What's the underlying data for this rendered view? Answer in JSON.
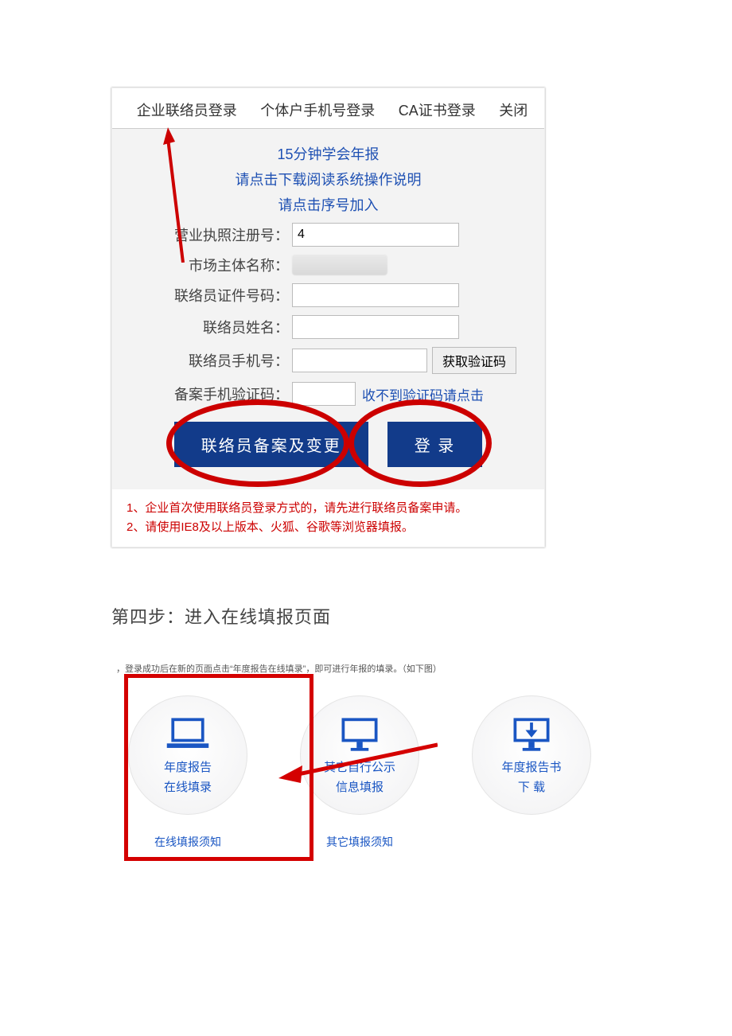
{
  "login": {
    "tabs": {
      "t1": "企业联络员登录",
      "t2": "个体户手机号登录",
      "t3": "CA证书登录",
      "close": "关闭"
    },
    "links": {
      "l1": "15分钟学会年报",
      "l2": "请点击下载阅读系统操作说明",
      "l3": "请点击序号加入"
    },
    "fields": {
      "reg_label": "营业执照注册号：",
      "reg_value": "4",
      "name_label": "市场主体名称：",
      "name_value": "",
      "id_label": "联络员证件号码：",
      "cname_label": "联络员姓名：",
      "phone_label": "联络员手机号：",
      "code_btn": "获取验证码",
      "verify_label": "备案手机验证码：",
      "no_code": "收不到验证码请点击"
    },
    "buttons": {
      "record": "联络员备案及变更",
      "login": "登 录"
    },
    "notes": {
      "n1": "1、企业首次使用联络员登录方式的，请先进行联络员备案申请。",
      "n2": "2、请使用IE8及以上版本、火狐、谷歌等浏览器填报。"
    }
  },
  "step4_title": "第四步：进入在线填报页面",
  "truncated_hint": "，登录成功后在新的页面点击“年度报告在线填录”，即可进行年报的填录。（如下图）",
  "cards": {
    "c1": {
      "l1": "年度报告",
      "l2": "在线填录",
      "sub": "在线填报须知"
    },
    "c2": {
      "l1": "其它自行公示",
      "l2": "信息填报",
      "sub": "其它填报须知"
    },
    "c3": {
      "l1": "年度报告书",
      "l2": "下 载",
      "sub": ""
    }
  }
}
